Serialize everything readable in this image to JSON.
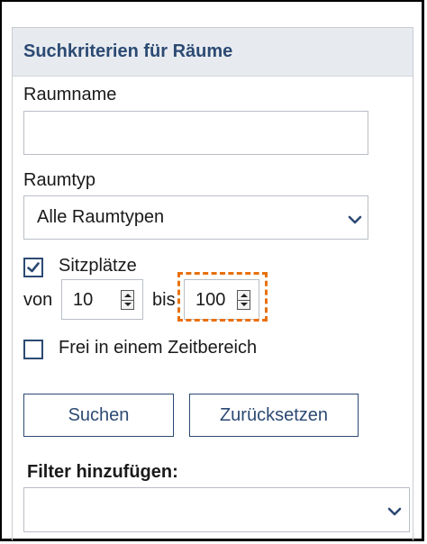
{
  "panel": {
    "title": "Suchkriterien für Räume"
  },
  "room_name": {
    "label": "Raumname",
    "value": "",
    "placeholder": ""
  },
  "room_type": {
    "label": "Raumtyp",
    "selected": "Alle Raumtypen"
  },
  "seats": {
    "checked": true,
    "label": "Sitzplätze",
    "from_label": "von",
    "from_value": "10",
    "to_label": "bis",
    "to_value": "100"
  },
  "free_time": {
    "checked": false,
    "label": "Frei in einem Zeitbereich"
  },
  "buttons": {
    "search": "Suchen",
    "reset": "Zurücksetzen"
  },
  "filter": {
    "label": "Filter hinzufügen:",
    "selected": ""
  },
  "icons": {
    "dropdown": "chevron-down-icon",
    "checkbox": "checkmark-icon",
    "stepper": "spinner-arrows-icon"
  },
  "colors": {
    "accent": "#2c4a73",
    "focus": "#e8700d",
    "header_bg": "#e7ebf0"
  }
}
